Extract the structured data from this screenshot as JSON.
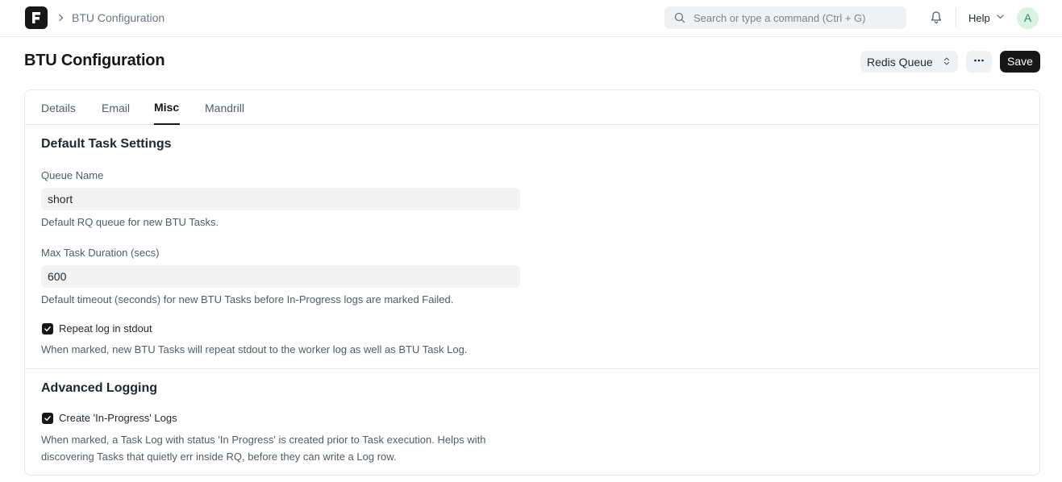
{
  "navbar": {
    "breadcrumb": "BTU Configuration",
    "search_placeholder": "Search or type a command (Ctrl + G)",
    "help_label": "Help",
    "avatar_initial": "A"
  },
  "page": {
    "title": "BTU Configuration",
    "queue_select_value": "Redis Queue",
    "save_label": "Save"
  },
  "tabs": [
    {
      "label": "Details",
      "active": false
    },
    {
      "label": "Email",
      "active": false
    },
    {
      "label": "Misc",
      "active": true
    },
    {
      "label": "Mandrill",
      "active": false
    }
  ],
  "sections": {
    "default_task": {
      "title": "Default Task Settings",
      "queue_name": {
        "label": "Queue Name",
        "value": "short",
        "description": "Default RQ queue for new BTU Tasks."
      },
      "max_duration": {
        "label": "Max Task Duration (secs)",
        "value": "600",
        "description": "Default timeout (seconds) for new BTU Tasks before In-Progress logs are marked Failed."
      },
      "repeat_log": {
        "label": "Repeat log in stdout",
        "checked": true,
        "description": "When marked, new BTU Tasks will repeat stdout to the worker log as well as BTU Task Log."
      }
    },
    "advanced_logging": {
      "title": "Advanced Logging",
      "in_progress_logs": {
        "label": "Create 'In-Progress' Logs",
        "checked": true,
        "description_line1": "When marked, a Task Log with status 'In Progress' is created prior to Task execution. Helps with",
        "description_line2": "discovering Tasks that quietly err inside RQ, before they can write a Log row."
      }
    }
  }
}
